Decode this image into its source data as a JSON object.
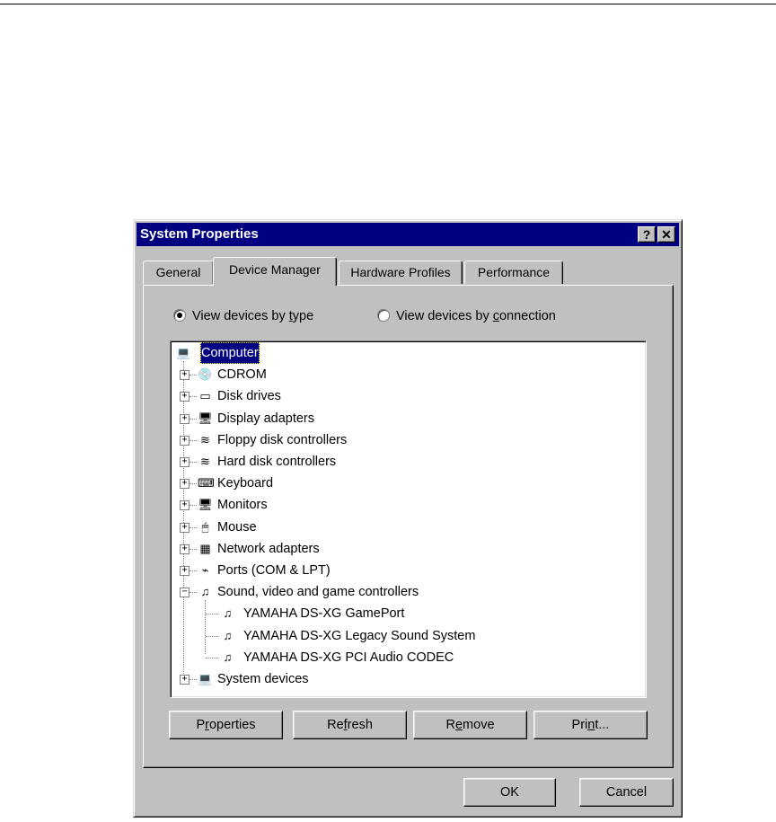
{
  "window": {
    "title": "System Properties",
    "help_glyph": "?",
    "close_glyph": "✕"
  },
  "tabs": [
    {
      "label": "General",
      "active": false
    },
    {
      "label": "Device Manager",
      "active": true
    },
    {
      "label": "Hardware Profiles",
      "active": false
    },
    {
      "label": "Performance",
      "active": false
    }
  ],
  "view_options": [
    {
      "pre": "View devices by ",
      "key": "t",
      "post": "ype",
      "selected": true
    },
    {
      "pre": "View devices by ",
      "key": "c",
      "post": "onnection",
      "selected": false
    }
  ],
  "tree": {
    "root": {
      "label": "Computer",
      "icon": "computer-icon"
    },
    "items": [
      {
        "label": "CDROM",
        "icon": "cdrom-icon",
        "expander": "+"
      },
      {
        "label": "Disk drives",
        "icon": "disk-drive-icon",
        "expander": "+"
      },
      {
        "label": "Display adapters",
        "icon": "display-adapter-icon",
        "expander": "+"
      },
      {
        "label": "Floppy disk controllers",
        "icon": "floppy-controller-icon",
        "expander": "+"
      },
      {
        "label": "Hard disk controllers",
        "icon": "hard-disk-controller-icon",
        "expander": "+"
      },
      {
        "label": "Keyboard",
        "icon": "keyboard-icon",
        "expander": "+"
      },
      {
        "label": "Monitors",
        "icon": "monitor-icon",
        "expander": "+"
      },
      {
        "label": "Mouse",
        "icon": "mouse-icon",
        "expander": "+"
      },
      {
        "label": "Network adapters",
        "icon": "network-adapter-icon",
        "expander": "+"
      },
      {
        "label": "Ports (COM & LPT)",
        "icon": "port-icon",
        "expander": "+"
      },
      {
        "label": "Sound, video and game controllers",
        "icon": "sound-controller-icon",
        "expander": "−",
        "children": [
          {
            "label": "YAMAHA DS-XG GamePort",
            "icon": "sound-device-icon"
          },
          {
            "label": "YAMAHA DS-XG Legacy Sound System",
            "icon": "sound-device-icon"
          },
          {
            "label": "YAMAHA DS-XG PCI Audio CODEC",
            "icon": "sound-device-icon"
          }
        ]
      },
      {
        "label": "System devices",
        "icon": "system-devices-icon",
        "expander": "+"
      }
    ]
  },
  "action_buttons": [
    {
      "pre": "P",
      "key": "r",
      "post": "operties"
    },
    {
      "pre": "Re",
      "key": "f",
      "post": "resh"
    },
    {
      "pre": "R",
      "key": "e",
      "post": "move"
    },
    {
      "pre": "Pri",
      "key": "n",
      "post": "t..."
    }
  ],
  "footer": {
    "ok_label": "OK",
    "cancel_label": "Cancel"
  }
}
